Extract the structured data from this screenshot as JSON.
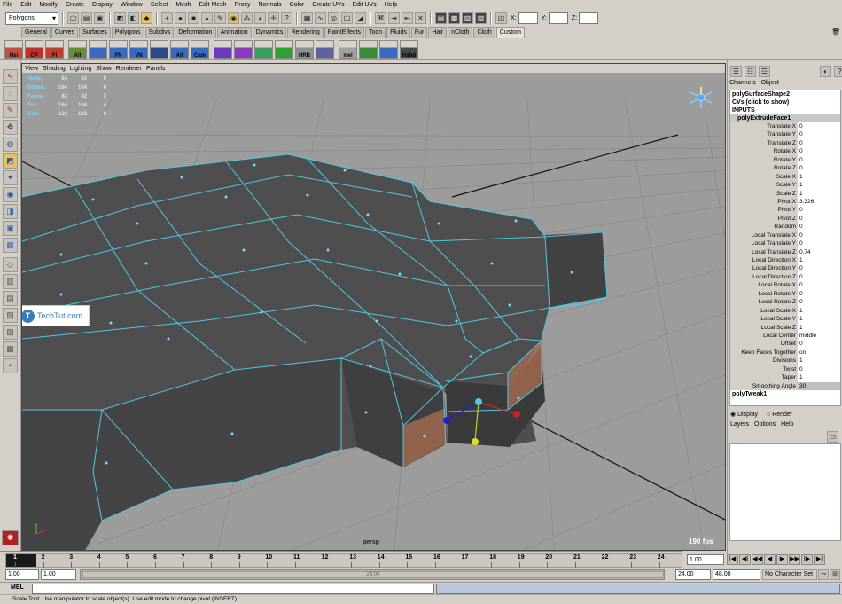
{
  "menubar": {
    "items": [
      "File",
      "Edit",
      "Modify",
      "Create",
      "Display",
      "Window",
      "Select",
      "Mesh",
      "Edit Mesh",
      "Proxy",
      "Normals",
      "Color",
      "Create UVs",
      "Edit UVs",
      "Help"
    ]
  },
  "status_line": {
    "mode": "Polygons",
    "coord_labels": [
      "X:",
      "Y:",
      "Z:"
    ]
  },
  "shelf": {
    "tabs": [
      "General",
      "Curves",
      "Surfaces",
      "Polygons",
      "Subdivs",
      "Deformation",
      "Animation",
      "Dynamics",
      "Rendering",
      "PaintEffects",
      "Toon",
      "Fluids",
      "Fur",
      "Hair",
      "nCloth",
      "Cloth",
      "Custom"
    ],
    "active_tab": "Custom",
    "buttons": [
      "Hsi",
      "CP",
      "FI",
      "All",
      "",
      "FN",
      "VN",
      "",
      "All",
      "Cam",
      "",
      "",
      "",
      "",
      "HRB",
      "",
      "mel",
      "",
      "",
      "Hshd"
    ]
  },
  "viewport": {
    "menu": [
      "View",
      "Shading",
      "Lighting",
      "Show",
      "Renderer",
      "Panels"
    ],
    "hud": [
      {
        "label": "Verts:",
        "a": "84",
        "b": "84",
        "c": "0"
      },
      {
        "label": "Edges:",
        "a": "164",
        "b": "164",
        "c": "0"
      },
      {
        "label": "Faces:",
        "a": "82",
        "b": "82",
        "c": "2"
      },
      {
        "label": "Tris:",
        "a": "164",
        "b": "164",
        "c": "4"
      },
      {
        "label": "UVs:",
        "a": "122",
        "b": "122",
        "c": "8"
      }
    ],
    "camera": "persp",
    "fps": "190 fps",
    "watermark": "TechTut.com"
  },
  "channel_box": {
    "tabs": [
      "Channels",
      "Object"
    ],
    "shape": "polySurfaceShape2",
    "cvs": "CVs (click to show)",
    "inputs": "INPUTS",
    "node": "polyExtrudeFace1",
    "attrs": [
      {
        "n": "Translate X",
        "v": "0"
      },
      {
        "n": "Translate Y",
        "v": "0"
      },
      {
        "n": "Translate Z",
        "v": "0"
      },
      {
        "n": "Rotate X",
        "v": "0"
      },
      {
        "n": "Rotate Y",
        "v": "0"
      },
      {
        "n": "Rotate Z",
        "v": "0"
      },
      {
        "n": "Scale X",
        "v": "1"
      },
      {
        "n": "Scale Y",
        "v": "1"
      },
      {
        "n": "Scale Z",
        "v": "1"
      },
      {
        "n": "Pivot X",
        "v": "3.326"
      },
      {
        "n": "Pivot Y",
        "v": "0"
      },
      {
        "n": "Pivot Z",
        "v": "0"
      },
      {
        "n": "Random",
        "v": "0"
      },
      {
        "n": "Local Translate X",
        "v": "0"
      },
      {
        "n": "Local Translate Y",
        "v": "0"
      },
      {
        "n": "Local Translate Z",
        "v": "0.74"
      },
      {
        "n": "Local Direction X",
        "v": "1"
      },
      {
        "n": "Local Direction Y",
        "v": "0"
      },
      {
        "n": "Local Direction Z",
        "v": "0"
      },
      {
        "n": "Local Rotate X",
        "v": "0"
      },
      {
        "n": "Local Rotate Y",
        "v": "0"
      },
      {
        "n": "Local Rotate Z",
        "v": "0"
      },
      {
        "n": "Local Scale X",
        "v": "1"
      },
      {
        "n": "Local Scale Y",
        "v": "1"
      },
      {
        "n": "Local Scale Z",
        "v": "1"
      },
      {
        "n": "Local Center",
        "v": "middle"
      },
      {
        "n": "Offset",
        "v": "0"
      },
      {
        "n": "Keep Faces Together",
        "v": "on"
      },
      {
        "n": "Divisions",
        "v": "1"
      },
      {
        "n": "Twist",
        "v": "0"
      },
      {
        "n": "Taper",
        "v": "1"
      },
      {
        "n": "Smoothing Angle",
        "v": "30"
      }
    ],
    "next_node": "polyTweak1"
  },
  "layer_editor": {
    "display": "Display",
    "render": "Render",
    "menu": [
      "Layers",
      "Options",
      "Help"
    ]
  },
  "timeline": {
    "ticks": [
      "1",
      "2",
      "3",
      "4",
      "5",
      "6",
      "7",
      "8",
      "9",
      "10",
      "11",
      "12",
      "13",
      "14",
      "15",
      "16",
      "17",
      "18",
      "19",
      "20",
      "21",
      "22",
      "23",
      "24"
    ],
    "current_frame": "1.00"
  },
  "range": {
    "start": "1.00",
    "inner_start": "1.00",
    "slider_label": "24.00",
    "inner_end": "24.00",
    "end": "48.00",
    "char_set": "No Character Set"
  },
  "mel": {
    "label": "MEL",
    "help": "Scale Tool: Use manipulator to scale object(s). Use edit mode to change pivot (INSERT)."
  }
}
